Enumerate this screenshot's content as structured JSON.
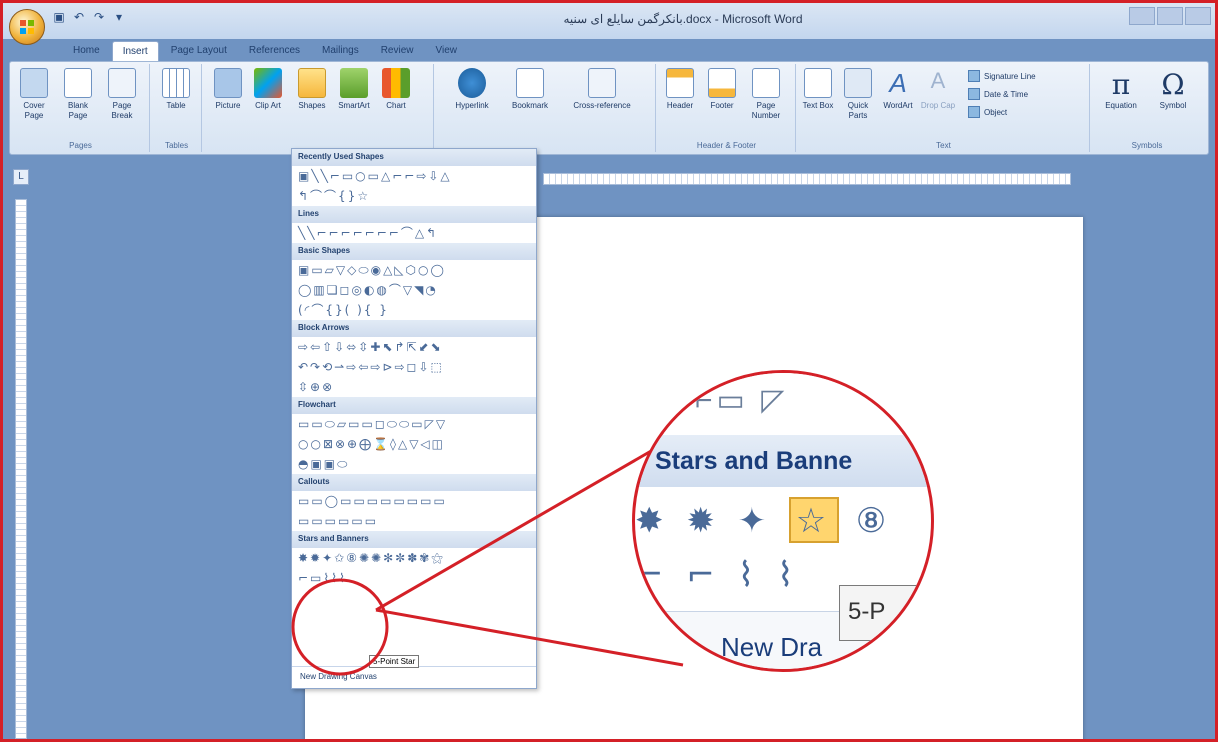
{
  "window": {
    "title": "بانکرگمن سایلع ای سنیه.docx - Microsoft Word"
  },
  "tabs": [
    "Home",
    "Insert",
    "Page Layout",
    "References",
    "Mailings",
    "Review",
    "View"
  ],
  "ribbon": {
    "pages": {
      "label": "Pages",
      "buttons": [
        "Cover Page",
        "Blank Page",
        "Page Break"
      ]
    },
    "tables": {
      "label": "Tables",
      "buttons": [
        "Table"
      ]
    },
    "illustrations": {
      "buttons": [
        "Picture",
        "Clip Art",
        "Shapes",
        "SmartArt",
        "Chart"
      ]
    },
    "links": {
      "buttons": [
        "Hyperlink",
        "Bookmark",
        "Cross-reference"
      ]
    },
    "header_footer": {
      "label": "Header & Footer",
      "buttons": [
        "Header",
        "Footer",
        "Page Number"
      ]
    },
    "text": {
      "label": "Text",
      "buttons": [
        "Text Box",
        "Quick Parts",
        "WordArt",
        "Drop Cap"
      ],
      "small": [
        "Signature Line",
        "Date & Time",
        "Object"
      ]
    },
    "symbols": {
      "label": "Symbols",
      "buttons": [
        "Equation",
        "Symbol"
      ]
    }
  },
  "shapes_menu": {
    "sections": [
      {
        "title": "Recently Used Shapes",
        "rows": [
          "▣╲╲⌐▭○▭△⌐⌐⇨⇩△",
          "↰⌒⌒{}☆"
        ]
      },
      {
        "title": "Lines",
        "rows": [
          "╲╲⌐⌐⌐⌐⌐⌐⌐⌒△↰"
        ]
      },
      {
        "title": "Basic Shapes",
        "rows": [
          "▣▭▱▽◇⬭◉△◺⬡○◯",
          "◯▥❏◻◎◐◍⌒▽◥◔",
          "(◜⌒{}( ){ }"
        ]
      },
      {
        "title": "Block Arrows",
        "rows": [
          "⇨⇦⇧⇩⬄⇳✚⬉↱⇱⬋⬊",
          "↶↷⟲⇀⇨⇦⇨⊳⇨◻⇩⬚",
          "⇳⊕⊗"
        ]
      },
      {
        "title": "Flowchart",
        "rows": [
          "▭▭⬭▱▭▭◻⬭⬭▭◸▽",
          "○○⊠⊗⊕⨁⌛◊△▽◁◫",
          "◓▣▣⬭"
        ]
      },
      {
        "title": "Callouts",
        "rows": [
          "▭▭◯▭▭▭▭▭▭▭▭",
          "▭▭▭▭▭▭"
        ]
      },
      {
        "title": "Stars and Banners",
        "rows": [
          "✸✹✦✩⑧✺✺✻✼✽✾⚝",
          "⌐▭⌇⌇⌇"
        ]
      }
    ],
    "footer": "New Drawing Canvas",
    "tooltip": "5-Point Star"
  },
  "zoom": {
    "section_title": "Stars and Banne",
    "row1": [
      "✸",
      "✹",
      "✦",
      "☆",
      "⑧"
    ],
    "row2": [
      "⌐",
      "⌐",
      "⌇",
      "⌇"
    ],
    "tooltip": "5-P",
    "footer": "New Dra"
  }
}
